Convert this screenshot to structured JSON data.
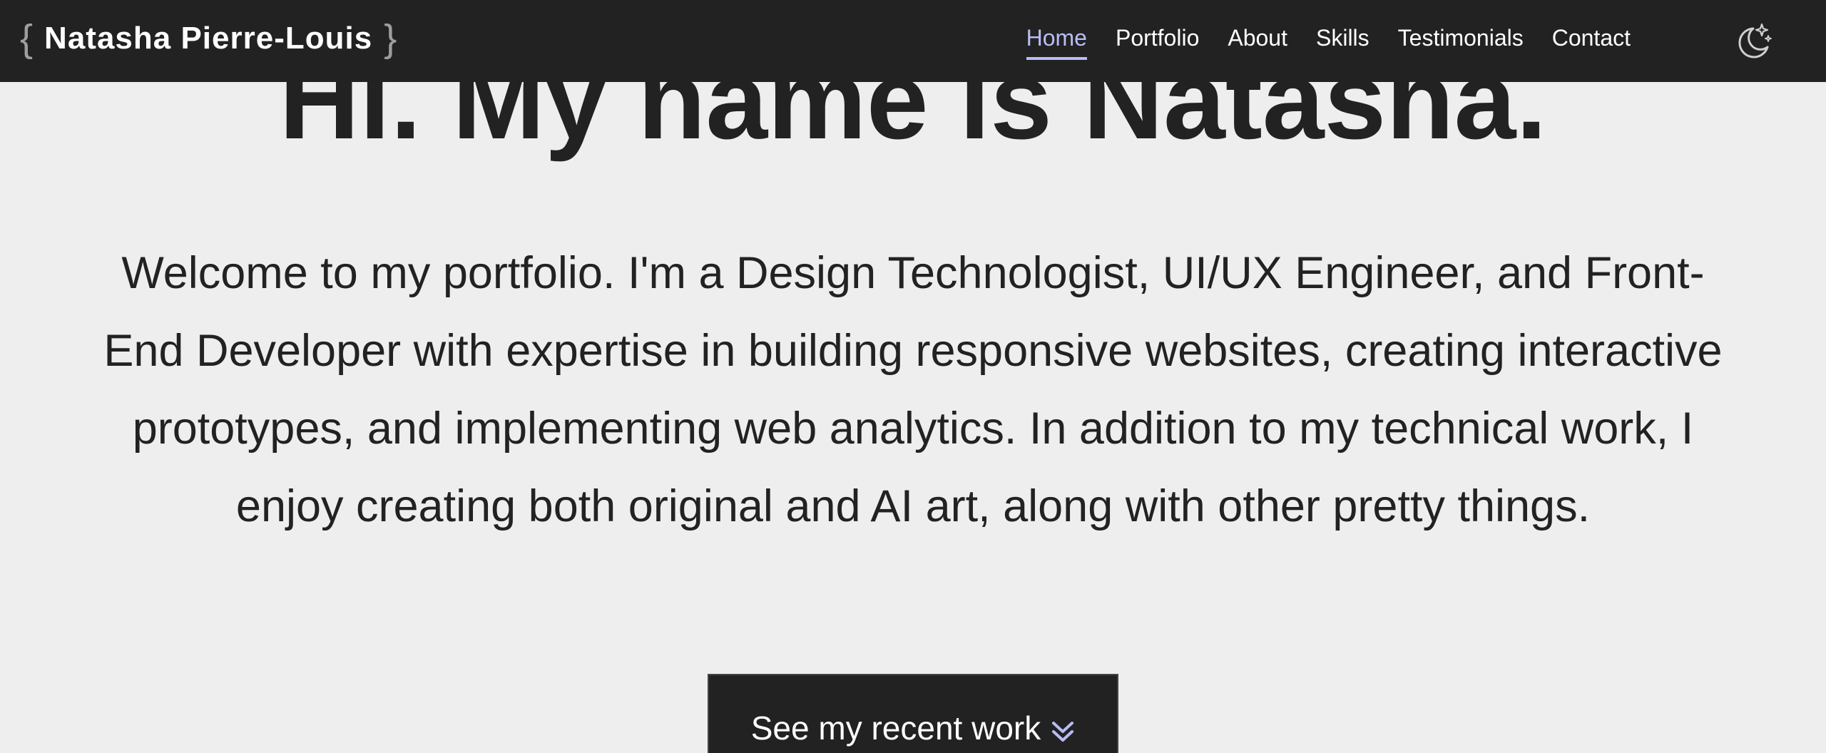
{
  "header": {
    "brace_open": "{",
    "brand_name": "Natasha Pierre-Louis",
    "brace_close": "}",
    "nav": [
      {
        "label": "Home",
        "active": true
      },
      {
        "label": "Portfolio",
        "active": false
      },
      {
        "label": "About",
        "active": false
      },
      {
        "label": "Skills",
        "active": false
      },
      {
        "label": "Testimonials",
        "active": false
      },
      {
        "label": "Contact",
        "active": false
      }
    ],
    "theme_toggle_icon": "moon-stars-icon"
  },
  "hero": {
    "title": "Hi. My name is Natasha.",
    "intro": "Welcome to my portfolio. I'm a Design Technologist, UI/UX Engineer, and Front-End Developer with expertise in building responsive websites, creating interactive prototypes, and implementing web analytics. In addition to my technical work, I enjoy creating both original and AI art, along with other pretty things.",
    "cta_label": "See my recent work",
    "cta_icon": "double-chevron-down-icon"
  },
  "colors": {
    "background": "#eeeeee",
    "header": "#222222",
    "accent": "#b8bdf5",
    "text": "#222222"
  }
}
